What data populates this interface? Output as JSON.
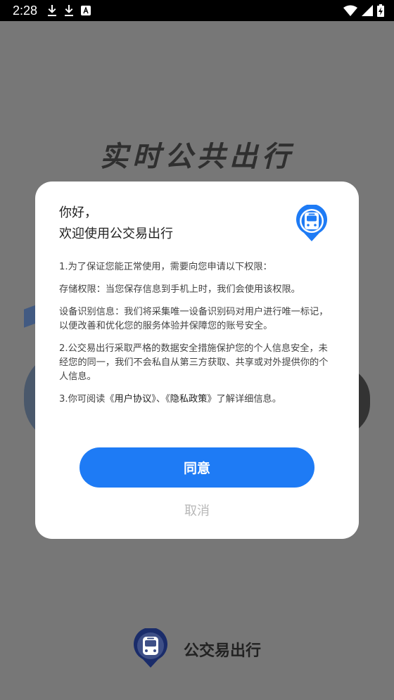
{
  "status_bar": {
    "time": "2:28",
    "left_icons": [
      "download-icon",
      "download-icon",
      "font-badge-icon"
    ],
    "right_icons": [
      "wifi-icon",
      "cellular-signal-icon",
      "battery-charging-icon"
    ]
  },
  "splash": {
    "title": "实时公共出行",
    "brand_name": "公交易出行"
  },
  "dialog": {
    "greeting_line1": "你好，",
    "greeting_line2": "欢迎使用公交易出行",
    "paragraphs": [
      "1.为了保证您能正常使用，需要向您申请以下权限：",
      "存储权限：当您保存信息到手机上时，我们会使用该权限。",
      "设备识别信息：我们将采集唯一设备识别码对用户进行唯一标记，以便改善和优化您的服务体验并保障您的账号安全。",
      "2.公交易出行采取严格的数据安全措施保护您的个人信息安全，未经您的同一，我们不会私自从第三方获取、共享或对外提供你的个人信息。"
    ],
    "para3_prefix": "3.你可阅读《",
    "user_agreement_link": "用户协议",
    "para3_mid": "》、《",
    "privacy_link": "隐私政策",
    "para3_suffix": "》了解详细信息。",
    "agree_label": "同意",
    "cancel_label": "取消"
  },
  "colors": {
    "accent": "#1e7bf5",
    "overlay": "#777777"
  }
}
